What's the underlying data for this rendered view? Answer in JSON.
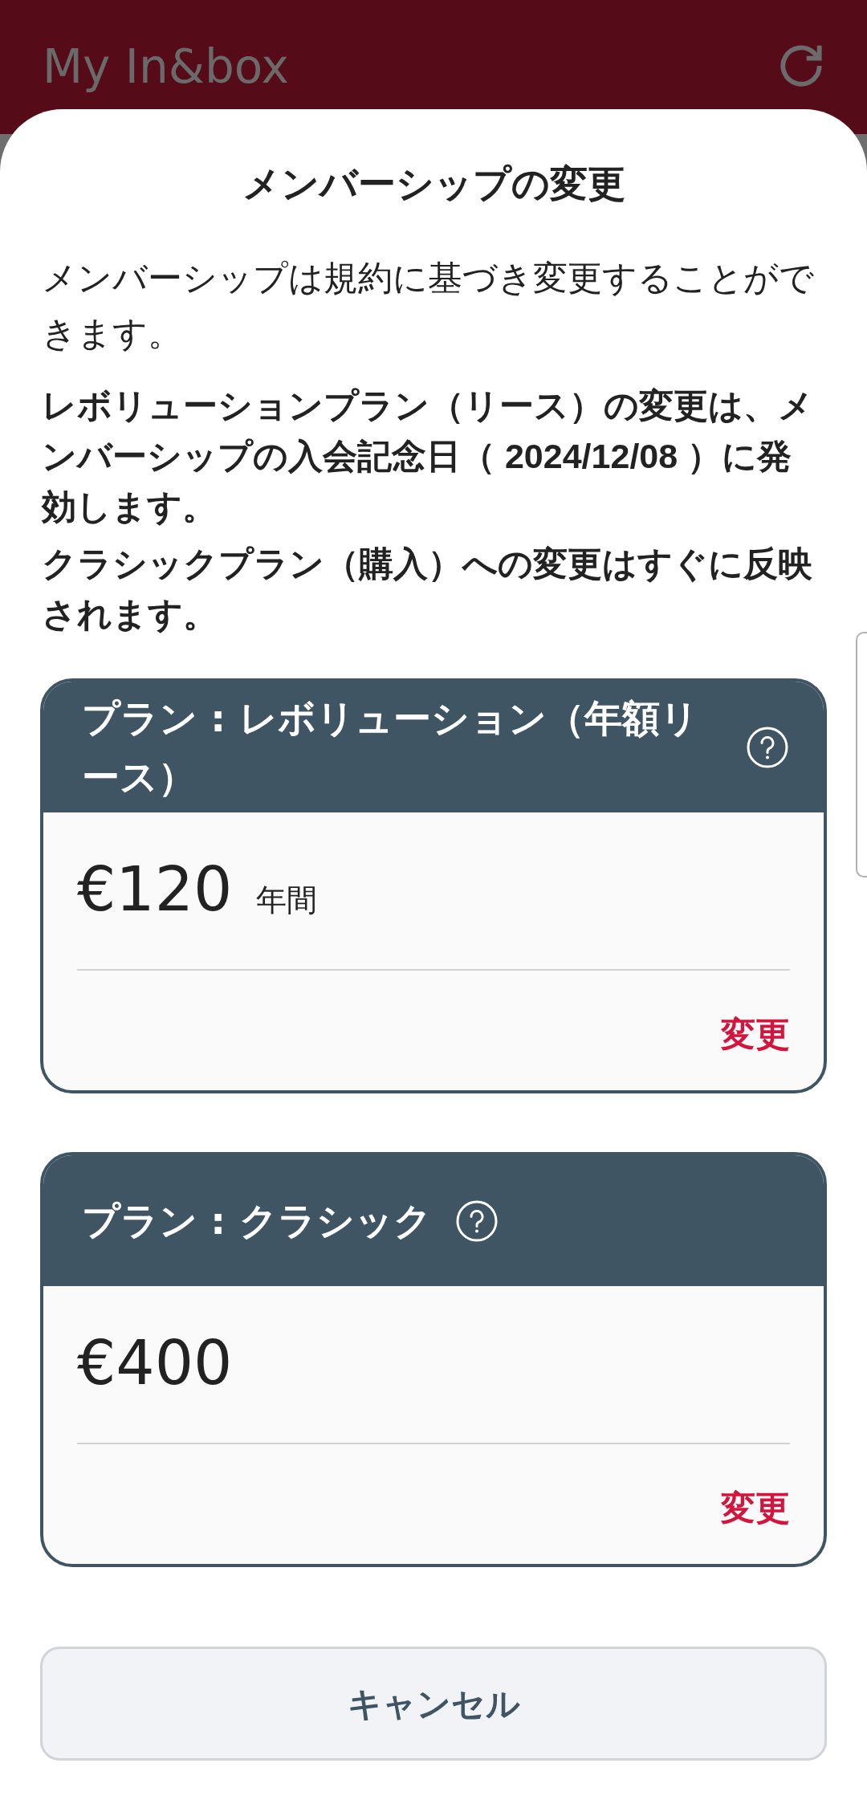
{
  "app_bar": {
    "title": "My In&box"
  },
  "sheet": {
    "title": "メンバーシップの変更",
    "description": "メンバーシップは規約に基づき変更することができます。",
    "notice_lines": [
      "レボリューションプラン（リース）の変更は、メンバーシップの入会記念日（ 2024/12/08 ）に発効します。",
      "クラシックプラン（購入）への変更はすぐに反映されます。"
    ],
    "plans": [
      {
        "title": "プラン : レボリューション（年額リース）",
        "price": "€120",
        "period": "年間",
        "action": "変更"
      },
      {
        "title": "プラン : クラシック",
        "price": "€400",
        "action": "変更"
      }
    ],
    "cancel_button": "キャンセル"
  }
}
